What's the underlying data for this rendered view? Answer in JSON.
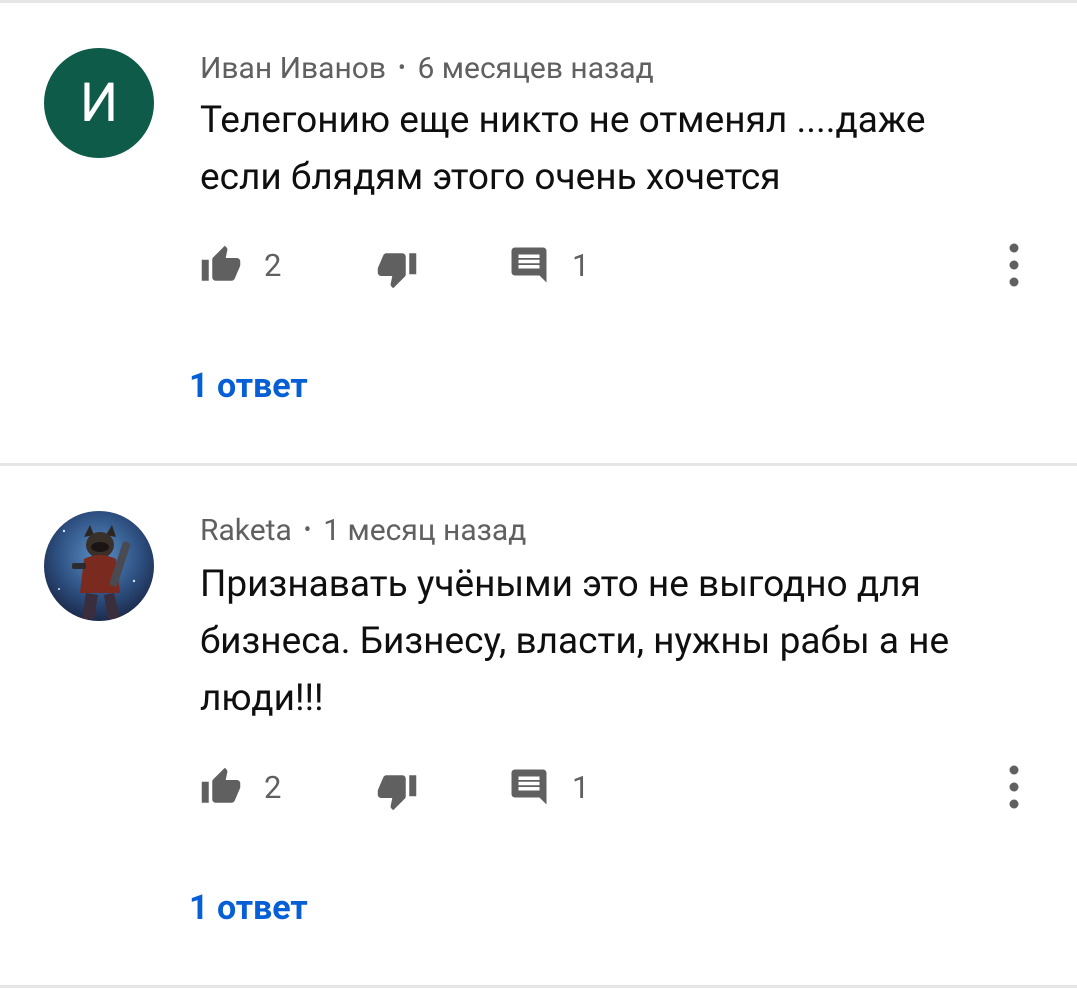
{
  "comments": [
    {
      "author": "Иван Иванов",
      "separator": "•",
      "time": "6 месяцев назад",
      "avatar_letter": "И",
      "avatar_color": "#0d5b48",
      "text_lines": [
        "Телегонию еще никто не отменял ....даже",
        "если блядям этого очень хочется"
      ],
      "likes": "2",
      "replies_count": "1",
      "replies_label": "1 ответ",
      "icons": {
        "like": "thumb-up-icon",
        "dislike": "thumb-down-icon",
        "reply": "comment-icon",
        "more": "more-vertical-icon"
      }
    },
    {
      "author": "Raketa",
      "separator": "•",
      "time": "1 месяц назад",
      "avatar_image": "raccoon-character-avatar",
      "text_lines": [
        "Признавать учёными это не выгодно для",
        "бизнеса. Бизнесу, власти, нужны рабы а не",
        "люди!!!"
      ],
      "likes": "2",
      "replies_count": "1",
      "replies_label": "1 ответ",
      "icons": {
        "like": "thumb-up-icon",
        "dislike": "thumb-down-icon",
        "reply": "comment-icon",
        "more": "more-vertical-icon"
      }
    }
  ],
  "colors": {
    "link": "#065fd4",
    "meta": "#606060",
    "text": "#0f0f0f",
    "divider": "#e5e5e5"
  }
}
